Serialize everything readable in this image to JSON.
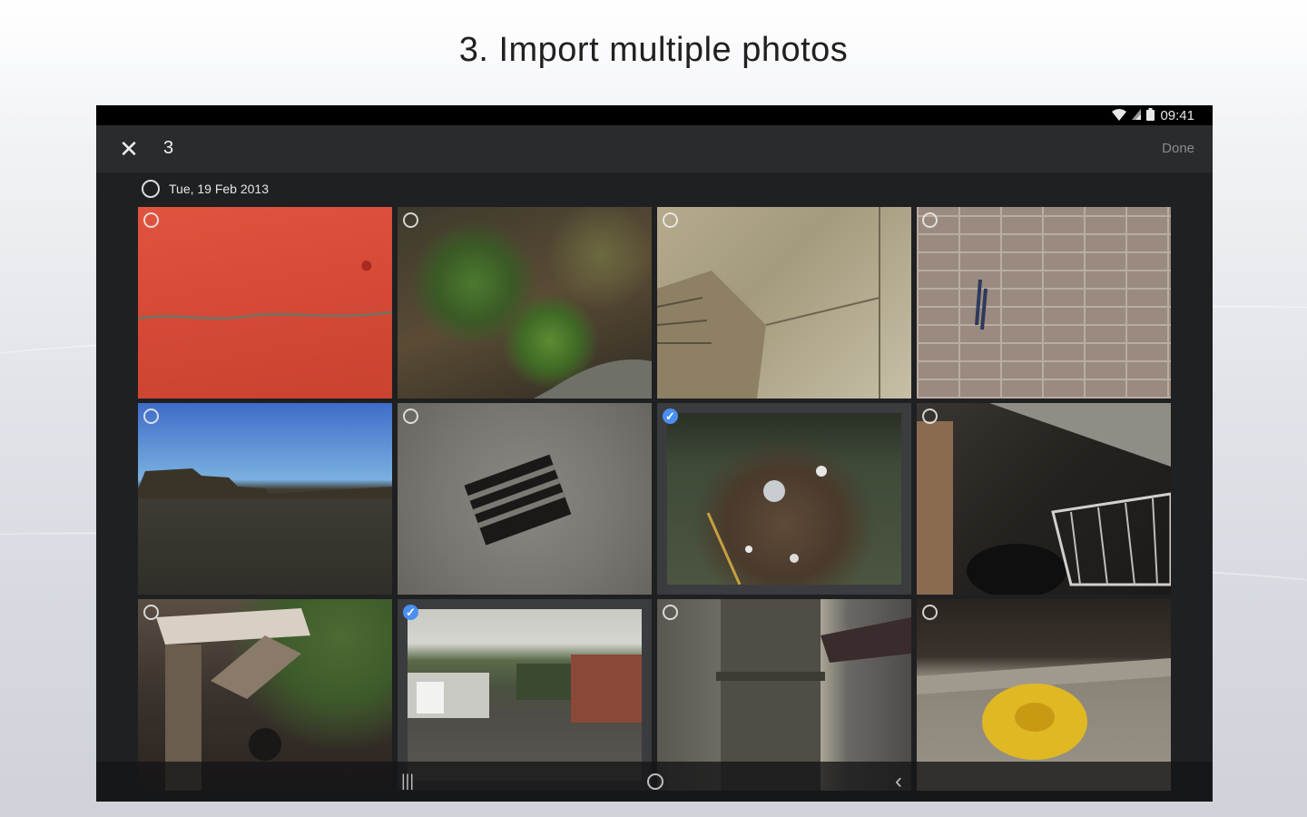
{
  "caption": "3.  Import multiple photos",
  "status_bar": {
    "time": "09:41",
    "icons": [
      "wifi-icon",
      "signal-icon",
      "battery-icon"
    ]
  },
  "toolbar": {
    "close_icon": "close-icon",
    "close_glyph": "✕",
    "selected_count": "3",
    "done_label": "Done"
  },
  "date_header": {
    "label": "Tue, 19 Feb 2013"
  },
  "photos": [
    {
      "name": "photo-red-wall",
      "selected": true
    },
    {
      "name": "photo-ground-weeds",
      "selected": false
    },
    {
      "name": "photo-broken-pavement",
      "selected": false
    },
    {
      "name": "photo-brick-wall",
      "selected": false
    },
    {
      "name": "photo-wall-blue-sky",
      "selected": false
    },
    {
      "name": "photo-drain-grate",
      "selected": false
    },
    {
      "name": "photo-litter-pile",
      "selected": true
    },
    {
      "name": "photo-shopping-trolley",
      "selected": false
    },
    {
      "name": "photo-collapsed-shed",
      "selected": false
    },
    {
      "name": "photo-garages",
      "selected": true
    },
    {
      "name": "photo-lamp-post",
      "selected": false
    },
    {
      "name": "photo-yellow-marking",
      "selected": false
    }
  ],
  "nav_bar": {
    "recents_glyph": "|||",
    "back_glyph": "‹",
    "icons": [
      "recents-icon",
      "home-icon",
      "back-icon"
    ]
  },
  "colors": {
    "selection_accent": "#4a8ff0",
    "app_background": "#1f2022",
    "toolbar_background": "#2a2b2d"
  }
}
